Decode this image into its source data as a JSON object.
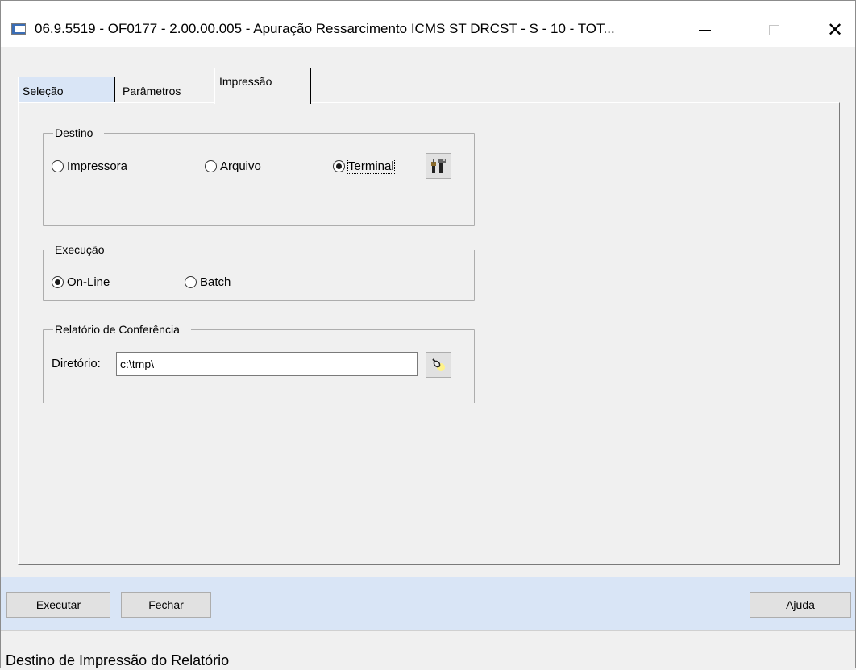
{
  "window": {
    "title": "06.9.5519 - OF0177 - 2.00.00.005 - Apuração Ressarcimento ICMS ST DRCST - S - 10 - TOT...",
    "minimize_glyph": "—",
    "maximize_glyph": "☐",
    "close_glyph": "✕"
  },
  "tabs": [
    {
      "label": "Seleção",
      "active": false
    },
    {
      "label": "Parâmetros",
      "active": false
    },
    {
      "label": "Impressão",
      "active": true
    }
  ],
  "destino": {
    "legend": "Destino",
    "options": [
      {
        "label": "Impressora",
        "selected": false
      },
      {
        "label": "Arquivo",
        "selected": false
      },
      {
        "label": "Terminal",
        "selected": true
      }
    ],
    "config_icon": "printer-config-icon"
  },
  "execucao": {
    "legend": "Execução",
    "options": [
      {
        "label": "On-Line",
        "selected": true
      },
      {
        "label": "Batch",
        "selected": false
      }
    ]
  },
  "relatorio": {
    "legend": "Relatório de Conferência",
    "directory_label": "Diretório:",
    "directory_value": "c:\\tmp\\",
    "browse_icon": "search-icon"
  },
  "buttons": {
    "execute": "Executar",
    "close": "Fechar",
    "help": "Ajuda"
  },
  "status": {
    "text": "Destino de Impressão do Relatório"
  }
}
